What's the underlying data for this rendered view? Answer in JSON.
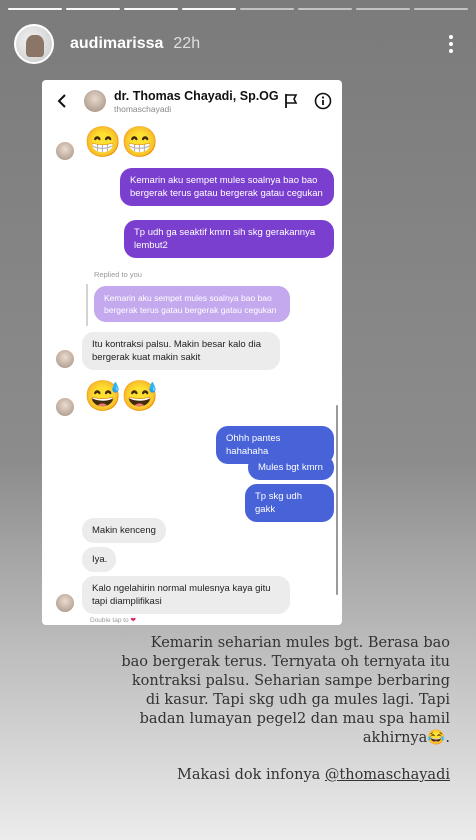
{
  "story": {
    "username": "audimarissa",
    "time": "22h"
  },
  "chat": {
    "contact_name": "dr. Thomas Chayadi, Sp.OG",
    "contact_handle": "thomaschayadi",
    "replied_label": "Replied to you",
    "double_tap_hint": "Double tap to",
    "messages": {
      "emoji1": "😁😁",
      "out1": "Kemarin aku sempet mules soalnya bao bao bergerak terus gatau bergerak gatau cegukan",
      "out2": "Tp udh ga seaktif kmrn sih skg gerakannya lembut2",
      "quoted": "Kemarin aku sempet mules soalnya bao bao bergerak terus gatau bergerak gatau cegukan",
      "in1": "Itu kontraksi palsu. Makin besar kalo dia bergerak kuat makin sakit",
      "emoji2": "😅😅",
      "out3": "Ohhh pantes hahahaha",
      "out4": "Mules bgt kmrn",
      "out5": "Tp skg udh gakk",
      "in2": "Makin kenceng",
      "in3": "Iya.",
      "in4": "Kalo ngelahirin normal mulesnya kaya gitu tapi diamplifikasi"
    }
  },
  "caption": {
    "body": "Kemarin seharian mules bgt. Berasa bao bao bergerak terus. Ternyata oh ternyata itu kontraksi palsu. Seharian sampe berbaring di kasur. Tapi skg udh ga mules lagi. Tapi badan lumayan pegel2 dan mau spa hamil akhirnya😂.",
    "thanks_prefix": "Makasi dok infonya ",
    "mention": "@thomaschayadi"
  },
  "colors": {
    "outgoing_purple": "#7b3fcf",
    "outgoing_blue": "#4862d8",
    "incoming_gray": "#ececec"
  },
  "icons": [
    "back-arrow-icon",
    "flag-icon",
    "info-icon",
    "more-icon",
    "heart-icon"
  ]
}
